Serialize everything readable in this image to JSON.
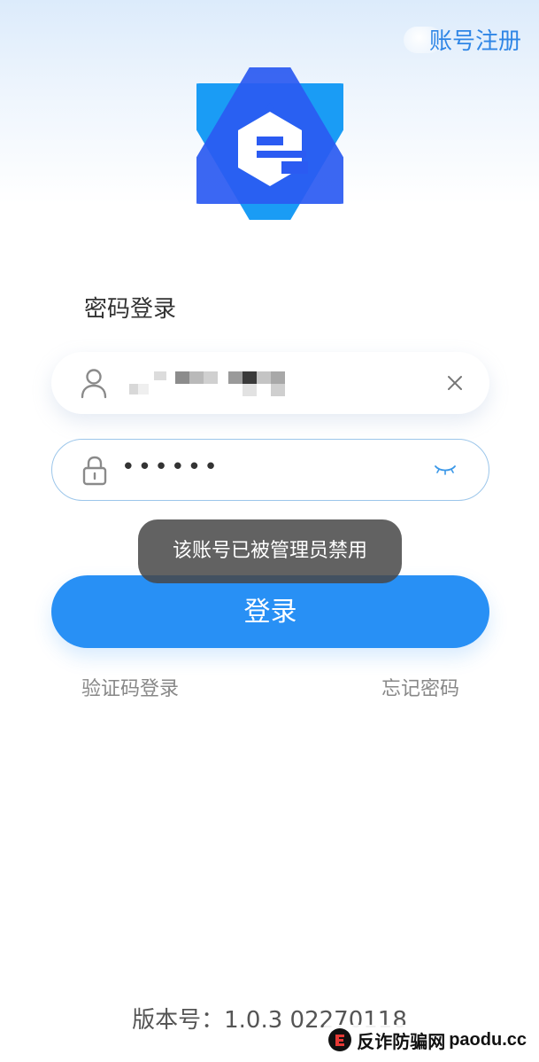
{
  "header": {
    "register_label": "账号注册"
  },
  "logo": {
    "icon": "brand-e-logo-icon",
    "colors": {
      "light_blue": "#1a9cf5",
      "dark_blue": "#2b5bf2",
      "letter": "#ffffff"
    }
  },
  "login": {
    "title": "密码登录",
    "username_value": "",
    "password_value": "••••••",
    "submit_label": "登录",
    "sms_login_label": "验证码登录",
    "forgot_password_label": "忘记密码"
  },
  "toast": {
    "message": "该账号已被管理员禁用"
  },
  "footer": {
    "version_text": "版本号：1.0.3 02270118"
  },
  "watermark": {
    "cn_text": "反诈防骗网",
    "en_text": "paodu.cc"
  },
  "colors": {
    "accent": "#2890f5",
    "link": "#2f86e6",
    "input_border": "#9cc6ea"
  }
}
